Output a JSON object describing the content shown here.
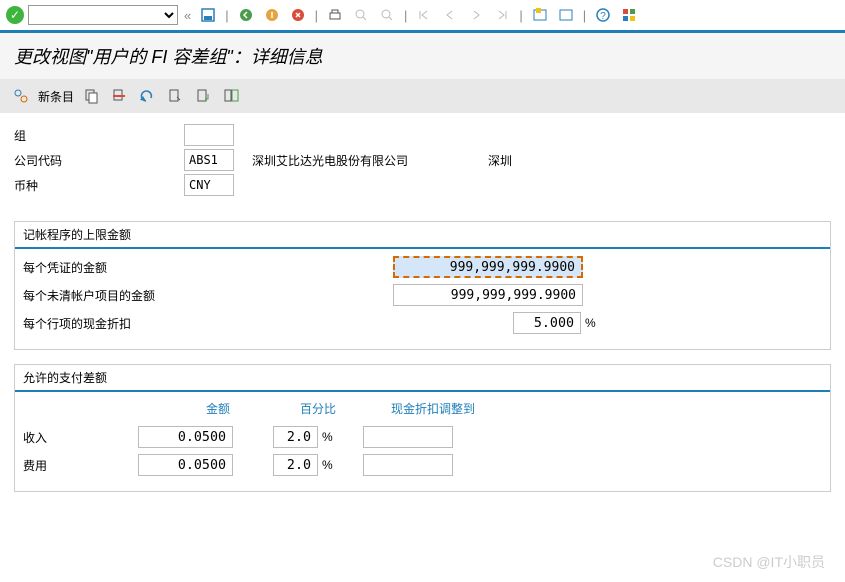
{
  "title": "更改视图\"用户的 FI 容差组\"：详细信息",
  "newEntry": "新条目",
  "fields": {
    "group": {
      "label": "组",
      "value": ""
    },
    "companyCode": {
      "label": "公司代码",
      "value": "ABS1",
      "name": "深圳艾比达光电股份有限公司",
      "city": "深圳"
    },
    "currency": {
      "label": "币种",
      "value": "CNY"
    }
  },
  "limits": {
    "title": "记帐程序的上限金额",
    "doc": {
      "label": "每个凭证的金额",
      "value": "999,999,999.9900"
    },
    "open": {
      "label": "每个未清帐户项目的金额",
      "value": "999,999,999.9900"
    },
    "disc": {
      "label": "每个行项的现金折扣",
      "value": "5.000",
      "unit": "%"
    }
  },
  "payment": {
    "title": "允许的支付差额",
    "head": {
      "amount": "金额",
      "pct": "百分比",
      "adj": "现金折扣调整到"
    },
    "income": {
      "label": "收入",
      "amount": "0.0500",
      "pct": "2.0",
      "unit": "%"
    },
    "expense": {
      "label": "费用",
      "amount": "0.0500",
      "pct": "2.0",
      "unit": "%"
    }
  },
  "watermark": "CSDN @IT小职员"
}
